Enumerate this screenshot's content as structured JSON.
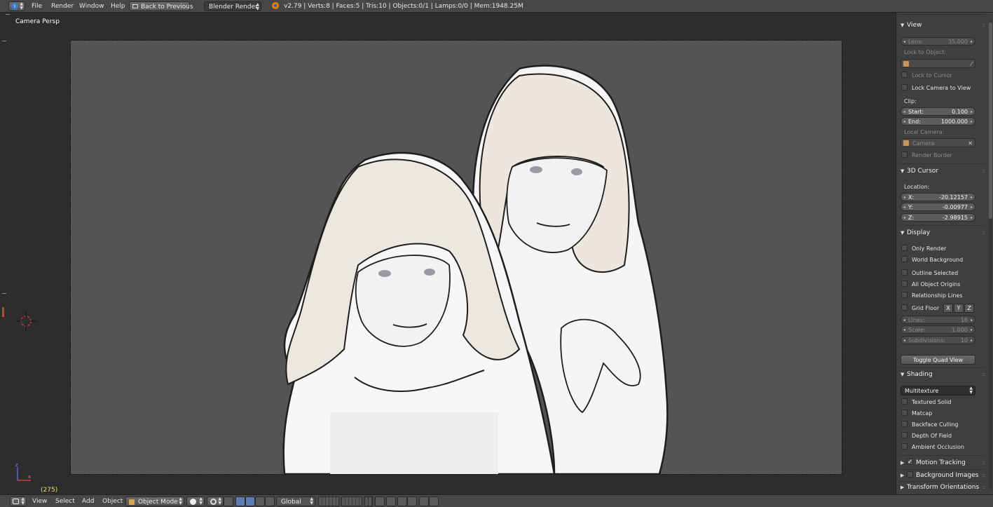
{
  "topbar": {
    "menus": [
      "File",
      "Render",
      "Window",
      "Help"
    ],
    "back_button": "Back to Previous",
    "render_engine": "Blender Render",
    "stats": "v2.79 | Verts:8 | Faces:5 | Tris:10 | Objects:0/1 | Lamps:0/0 | Mem:1948.25M"
  },
  "viewport": {
    "label": "Camera Persp",
    "frame": "(275)"
  },
  "props": {
    "view": {
      "header": "View",
      "lens_label": "Lens:",
      "lens_value": "35.000",
      "lock_to_object": "Lock to Object:",
      "lock_to_cursor": "Lock to Cursor",
      "lock_camera_to_view": "Lock Camera to View",
      "clip": "Clip:",
      "start_label": "Start:",
      "start_value": "0.100",
      "end_label": "End:",
      "end_value": "1000.000",
      "local_camera": "Local Camera:",
      "camera_name": "Camera",
      "render_border": "Render Border"
    },
    "cursor": {
      "header": "3D Cursor",
      "location": "Location:",
      "x_label": "X:",
      "x_value": "-20.12157",
      "y_label": "Y:",
      "y_value": "-0.00977",
      "z_label": "Z:",
      "z_value": "-2.98915"
    },
    "display": {
      "header": "Display",
      "only_render": "Only Render",
      "world_background": "World Background",
      "outline_selected": "Outline Selected",
      "all_object_origins": "All Object Origins",
      "relationship_lines": "Relationship Lines",
      "grid_floor": "Grid Floor",
      "x": "X",
      "y": "Y",
      "z": "Z",
      "lines_label": "Lines:",
      "lines_value": "16",
      "scale_label": "Scale:",
      "scale_value": "1.000",
      "subdivisions_label": "Subdivisions:",
      "subdivisions_value": "10",
      "toggle_quad_view": "Toggle Quad View"
    },
    "shading": {
      "header": "Shading",
      "mode": "Multitexture",
      "textured_solid": "Textured Solid",
      "matcap": "Matcap",
      "backface_culling": "Backface Culling",
      "depth_of_field": "Depth Of Field",
      "ambient_occlusion": "Ambient Occlusion"
    },
    "collapsed": {
      "motion_tracking": "Motion Tracking",
      "background_images": "Background Images",
      "transform_orientations": "Transform Orientations"
    }
  },
  "bottombar": {
    "menus": [
      "View",
      "Select",
      "Add",
      "Object"
    ],
    "mode": "Object Mode",
    "orientation": "Global"
  }
}
